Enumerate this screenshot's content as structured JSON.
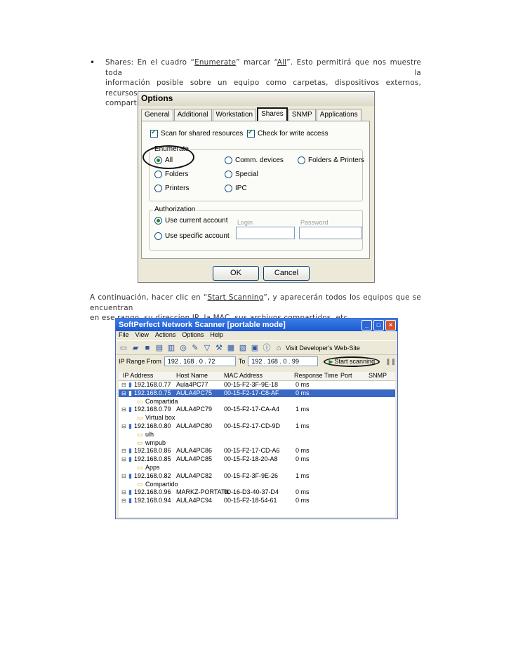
{
  "document": {
    "bullet_symbol": "•",
    "p1": {
      "line1_a": "Shares: En el cuadro “",
      "line1_u1": "Enumerate",
      "line1_b": "” marcar “",
      "line1_u2": "All",
      "line1_c": "”. Esto permitirá que nos muestre toda la",
      "line2": "información posible sobre un equipo como carpetas, dispositivos externos, recursos,",
      "line3": "compartido."
    },
    "p2": {
      "line1_a": "A continuación, hacer clic en “",
      "line1_u": "Start Scanning",
      "line1_b": "”, y aparecerán todos los equipos que se encuentran",
      "line2": "en ese rango, su direccion IP, la MAC, sus archivos compartidos, etc."
    }
  },
  "options_dialog": {
    "title": "Options",
    "tabs": [
      "General",
      "Additional",
      "Workstation",
      "Shares",
      "SNMP",
      "Applications"
    ],
    "active_tab": "Shares",
    "scan_shared": "Scan for shared resources",
    "check_write": "Check for write access",
    "enumerate_label": "Enumerate",
    "enumerate_options": [
      "All",
      "Comm. devices",
      "Folders & Printers",
      "Folders",
      "Special",
      "Printers",
      "IPC"
    ],
    "enumerate_selected": "All",
    "authorization_label": "Authorization",
    "auth_current": "Use current account",
    "auth_specific": "Use specific account",
    "login_label": "Login",
    "password_label": "Password",
    "ok": "OK",
    "cancel": "Cancel"
  },
  "scanner_window": {
    "title": "SoftPerfect Network Scanner [portable mode]",
    "menu": [
      "File",
      "View",
      "Actions",
      "Options",
      "Help"
    ],
    "visit_link": "Visit Developer's Web-Site",
    "ip_range_from_label": "IP Range From",
    "ip_from": "192 . 168 . 0 . 72",
    "to_label": "To",
    "ip_to": "192 . 168 . 0 . 99",
    "start_scanning": "Start scanning",
    "columns": [
      "IP Address",
      "Host Name",
      "MAC Address",
      "Response Time",
      "Port",
      "SNMP"
    ],
    "rows": [
      {
        "type": "host",
        "ip": "192.168.0.77",
        "host": "Aula4PC77",
        "mac": "00-15-F2-3F-9E-18",
        "resp": "0 ms"
      },
      {
        "type": "host",
        "ip": "192.168.0.75",
        "host": "AULA4PC75",
        "mac": "00-15-F2-17-C8-AF",
        "resp": "0 ms",
        "selected": true
      },
      {
        "type": "share",
        "name": "Compartida"
      },
      {
        "type": "host",
        "ip": "192.168.0.79",
        "host": "AULA4PC79",
        "mac": "00-15-F2-17-CA-A4",
        "resp": "1 ms"
      },
      {
        "type": "share",
        "name": "Virtual box"
      },
      {
        "type": "host",
        "ip": "192.168.0.80",
        "host": "AULA4PC80",
        "mac": "00-15-F2-17-CD-9D",
        "resp": "1 ms"
      },
      {
        "type": "share",
        "name": "ulh"
      },
      {
        "type": "share",
        "name": "wmpub"
      },
      {
        "type": "host",
        "ip": "192.168.0.86",
        "host": "AULA4PC86",
        "mac": "00-15-F2-17-CD-A6",
        "resp": "0 ms"
      },
      {
        "type": "host",
        "ip": "192.168.0.85",
        "host": "AULA4PC85",
        "mac": "00-15-F2-18-20-A8",
        "resp": "0 ms"
      },
      {
        "type": "share",
        "name": "Apps"
      },
      {
        "type": "host",
        "ip": "192.168.0.82",
        "host": "AULA4PC82",
        "mac": "00-15-F2-3F-9E-26",
        "resp": "1 ms"
      },
      {
        "type": "share",
        "name": "Compartido"
      },
      {
        "type": "host",
        "ip": "192.168.0.96",
        "host": "MARKZ-PORTATIL",
        "mac": "00-16-D3-40-37-D4",
        "resp": "0 ms"
      },
      {
        "type": "host",
        "ip": "192.168.0.94",
        "host": "AULA4PC94",
        "mac": "00-15-F2-18-54-61",
        "resp": "0 ms"
      }
    ]
  }
}
